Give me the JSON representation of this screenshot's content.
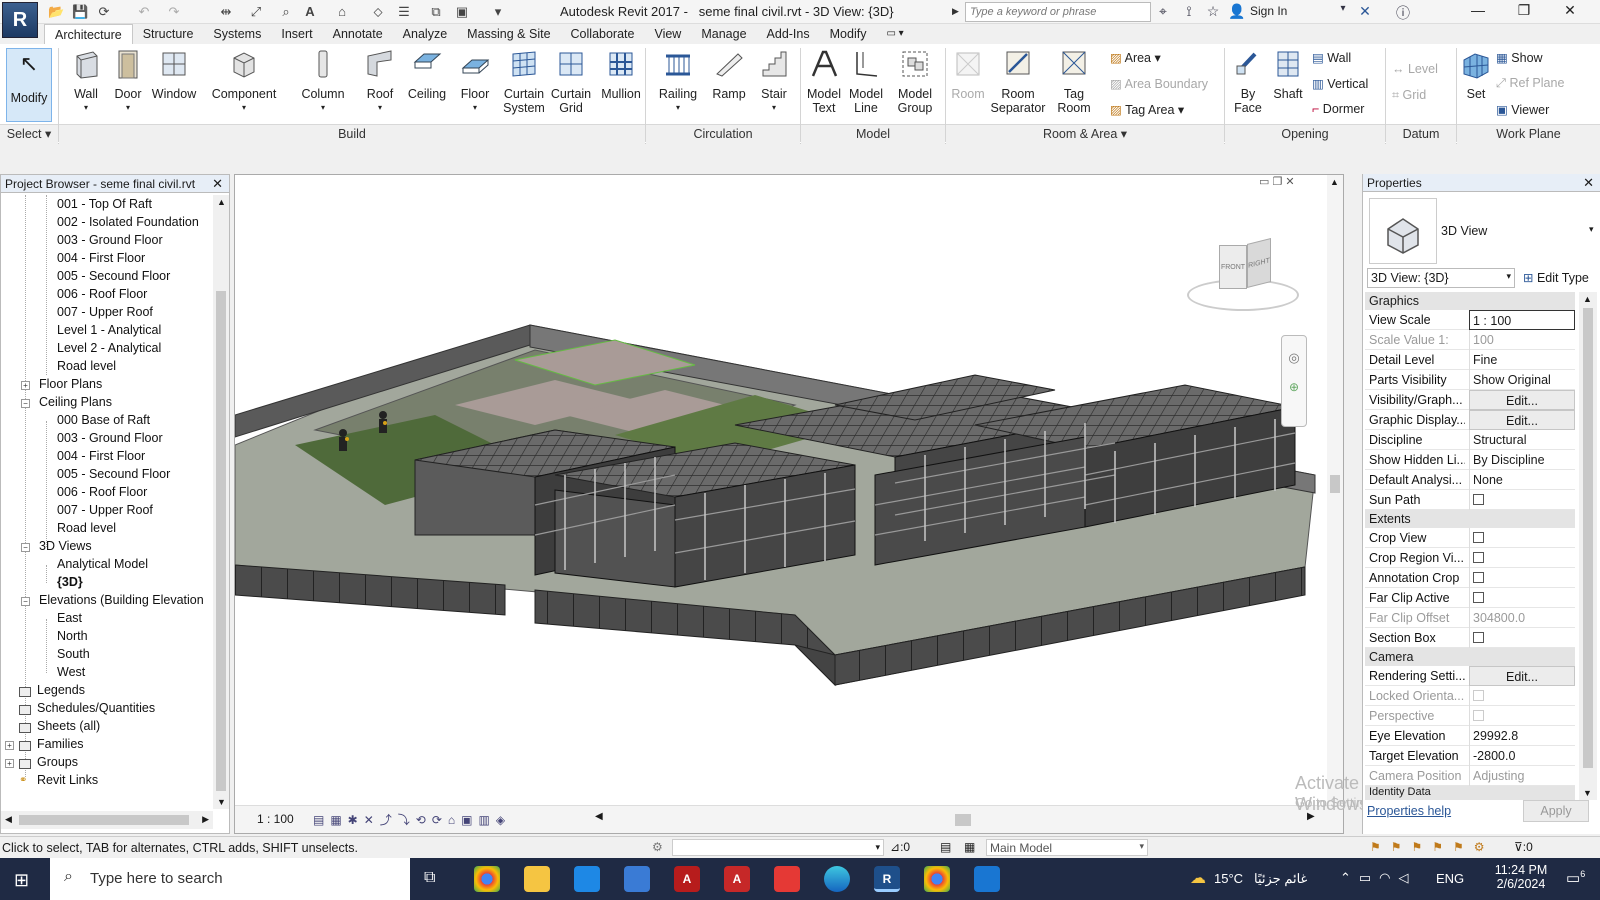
{
  "app": {
    "logo": "R",
    "title": "Autodesk Revit 2017 -",
    "document_title": "seme final civil.rvt - 3D View: {3D}"
  },
  "titlebar": {
    "search_placeholder": "Type a keyword or phrase",
    "sign_in": "Sign In"
  },
  "tabs": [
    "Architecture",
    "Structure",
    "Systems",
    "Insert",
    "Annotate",
    "Analyze",
    "Massing & Site",
    "Collaborate",
    "View",
    "Manage",
    "Add-Ins",
    "Modify"
  ],
  "ribbon": {
    "modify": "Modify",
    "select": "Select",
    "build": {
      "wall": "Wall",
      "door": "Door",
      "window": "Window",
      "component": "Component",
      "column": "Column",
      "roof": "Roof",
      "ceiling": "Ceiling",
      "floor": "Floor",
      "curtain_system_1": "Curtain",
      "curtain_system_2": "System",
      "curtain_grid_1": "Curtain",
      "curtain_grid_2": "Grid",
      "mullion": "Mullion",
      "label": "Build"
    },
    "circulation": {
      "railing": "Railing",
      "ramp": "Ramp",
      "stair": "Stair",
      "label": "Circulation"
    },
    "model": {
      "model_text_1": "Model",
      "model_text_2": "Text",
      "model_line_1": "Model",
      "model_line_2": "Line",
      "model_group_1": "Model",
      "model_group_2": "Group",
      "label": "Model"
    },
    "room_area": {
      "room": "Room",
      "room_sep_1": "Room",
      "room_sep_2": "Separator",
      "tag_room_1": "Tag",
      "tag_room_2": "Room",
      "area": "Area",
      "area_boundary": "Area  Boundary",
      "tag_area": "Tag  Area",
      "label": "Room & Area"
    },
    "opening": {
      "by_face_1": "By",
      "by_face_2": "Face",
      "shaft": "Shaft",
      "wall": "Wall",
      "vertical": "Vertical",
      "dormer": "Dormer",
      "label": "Opening"
    },
    "datum": {
      "level": "Level",
      "grid": "Grid",
      "label": "Datum"
    },
    "work_plane": {
      "set": "Set",
      "show": "Show",
      "ref_plane": "Ref  Plane",
      "viewer": "Viewer",
      "label": "Work Plane"
    }
  },
  "project_browser": {
    "title": "Project Browser - seme final civil.rvt",
    "items": {
      "a1": "001 - Top Of Raft",
      "a2": "002 - Isolated Foundation",
      "a3": "003 - Ground Floor",
      "a4": "004 - First Floor",
      "a5": "005 - Secound Floor",
      "a6": "006 - Roof Floor",
      "a7": "007 - Upper Roof",
      "a8": "Level 1 - Analytical",
      "a9": "Level 2 - Analytical",
      "a10": "Road level",
      "floor_plans": "Floor Plans",
      "ceiling_plans": "Ceiling Plans",
      "c1": "000 Base of Raft",
      "c2": "003 - Ground Floor",
      "c3": "004 - First Floor",
      "c4": "005 - Secound Floor",
      "c5": "006 - Roof Floor",
      "c6": "007 - Upper Roof",
      "c7": "Road level",
      "views_3d": "3D Views",
      "v1": "Analytical Model",
      "v2": "{3D}",
      "elevations": "Elevations (Building Elevation",
      "e1": "East",
      "e2": "North",
      "e3": "South",
      "e4": "West",
      "legends": "Legends",
      "schedules": "Schedules/Quantities",
      "sheets": "Sheets (all)",
      "families": "Families",
      "groups": "Groups",
      "revit_links": "Revit Links"
    }
  },
  "viewcube": {
    "front": "FRONT",
    "right": "RIGHT"
  },
  "view_controls": {
    "scale": "1 : 100"
  },
  "properties": {
    "title": "Properties",
    "type_name": "3D View",
    "selector": "3D View: {3D}",
    "edit_type": "Edit Type",
    "groups": {
      "graphics": "Graphics",
      "extents": "Extents",
      "camera": "Camera",
      "identity": "Identity Data"
    },
    "rows": {
      "view_scale": {
        "k": "View Scale",
        "v": "1 : 100"
      },
      "scale_value": {
        "k": "Scale Value    1:",
        "v": "100"
      },
      "detail_level": {
        "k": "Detail Level",
        "v": "Fine"
      },
      "parts_visibility": {
        "k": "Parts Visibility",
        "v": "Show Original"
      },
      "vis_graph": {
        "k": "Visibility/Graph...",
        "v": "Edit..."
      },
      "graphic_display": {
        "k": "Graphic Display...",
        "v": "Edit..."
      },
      "discipline": {
        "k": "Discipline",
        "v": "Structural"
      },
      "show_hidden": {
        "k": "Show Hidden Li...",
        "v": "By Discipline"
      },
      "default_analysis": {
        "k": "Default Analysi...",
        "v": "None"
      },
      "sun_path": {
        "k": "Sun Path"
      },
      "crop_view": {
        "k": "Crop View"
      },
      "crop_region": {
        "k": "Crop Region Vi..."
      },
      "annotation_crop": {
        "k": "Annotation Crop"
      },
      "far_clip_active": {
        "k": "Far Clip Active"
      },
      "far_clip_offset": {
        "k": "Far Clip Offset",
        "v": "304800.0"
      },
      "section_box": {
        "k": "Section Box"
      },
      "rendering": {
        "k": "Rendering Setti...",
        "v": "Edit..."
      },
      "locked_orient": {
        "k": "Locked Orienta..."
      },
      "perspective": {
        "k": "Perspective"
      },
      "eye_elevation": {
        "k": "Eye Elevation",
        "v": "29992.8"
      },
      "target_elevation": {
        "k": "Target Elevation",
        "v": "-2800.0"
      },
      "camera_position": {
        "k": "Camera Position",
        "v": "Adjusting"
      }
    },
    "help": "Properties help",
    "apply": "Apply"
  },
  "status": {
    "text": "Click to select, TAB for alternates, CTRL adds, SHIFT unselects.",
    "counter": ":0",
    "model": "Main Model",
    "filter": ":0"
  },
  "watermark": {
    "line1": "Activate Windows",
    "line2": "Go to Settings to activate Windows."
  },
  "taskbar": {
    "search": "Type here to search",
    "weather": "15°C",
    "weather_desc": "غائم جزئيًا",
    "lang": "ENG",
    "time": "11:24 PM",
    "date": "2/6/2024",
    "notif": "6"
  },
  "colors": {
    "ribbon_bg": "#ffffff",
    "accent": "#2b5797",
    "taskbar": "#1f2a44",
    "view_bg": "#ffffff"
  }
}
